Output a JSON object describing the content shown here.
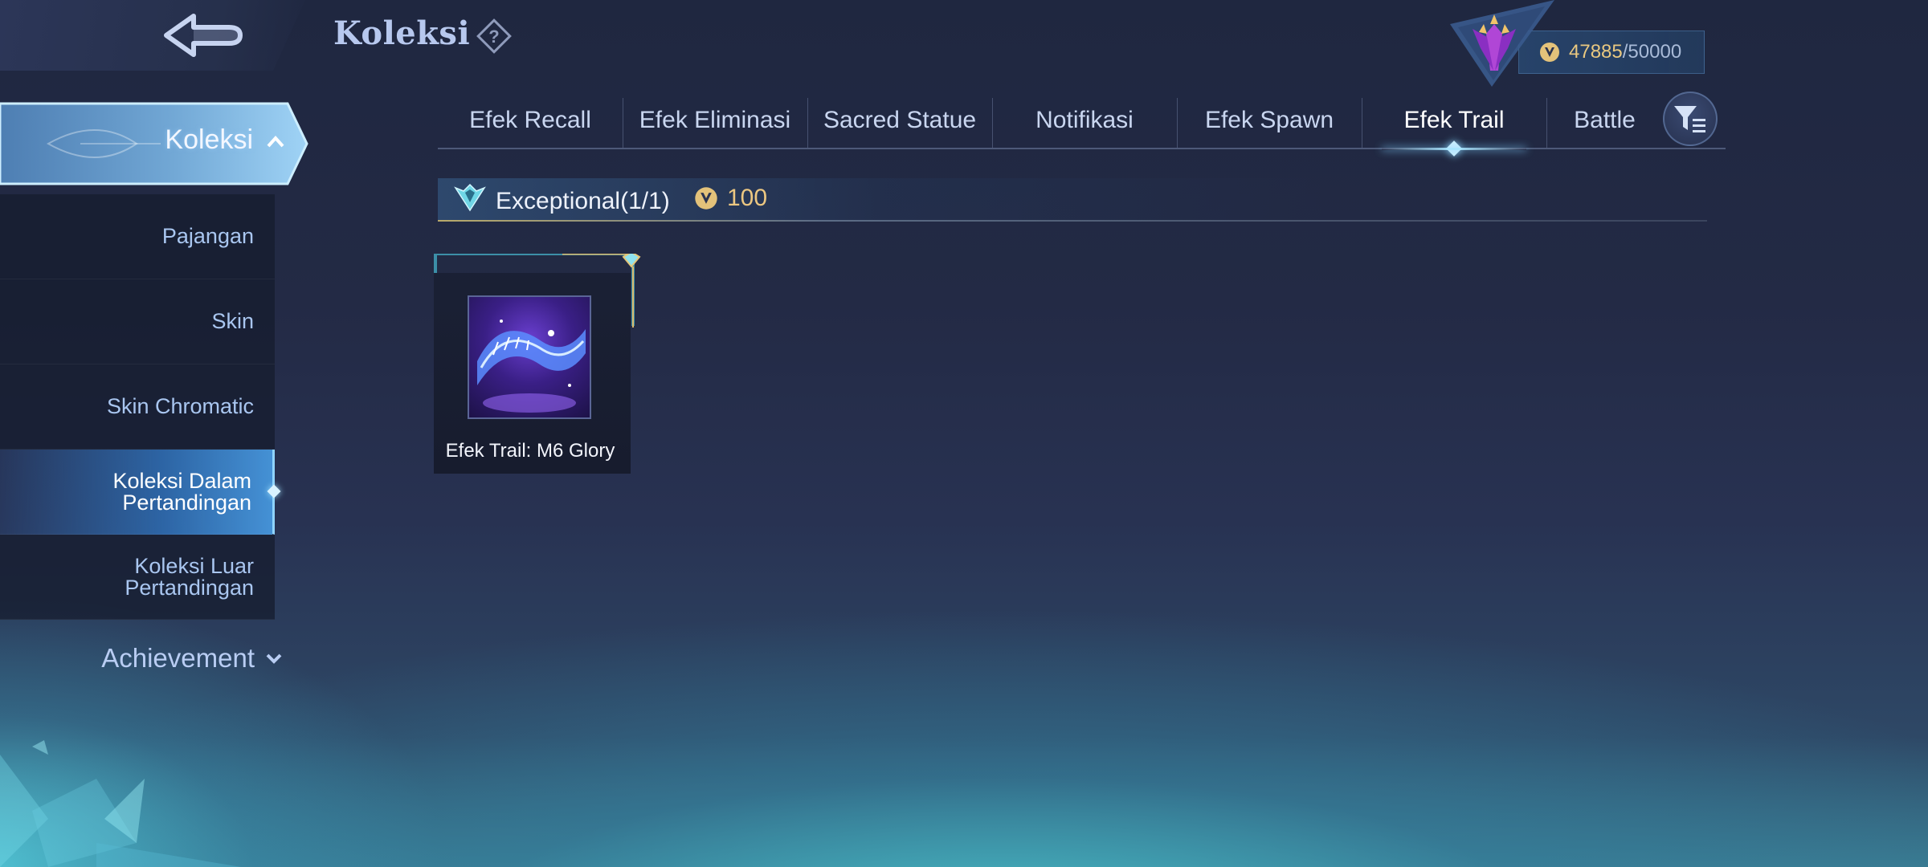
{
  "header": {
    "title": "Koleksi",
    "points": {
      "current": "47885",
      "separator": "/",
      "max": "50000"
    }
  },
  "sidebar": {
    "main": {
      "label": "Koleksi"
    },
    "items": [
      {
        "label": "Pajangan"
      },
      {
        "label": "Skin"
      },
      {
        "label": "Skin Chromatic"
      },
      {
        "label": "Koleksi Dalam Pertandingan",
        "active": true
      },
      {
        "label": "Koleksi Luar Pertandingan"
      }
    ],
    "achievement": {
      "label": "Achievement"
    }
  },
  "tabs": [
    {
      "label": "Efek Recall"
    },
    {
      "label": "Efek Eliminasi"
    },
    {
      "label": "Sacred Statue"
    },
    {
      "label": "Notifikasi"
    },
    {
      "label": "Efek Spawn"
    },
    {
      "label": "Efek Trail",
      "active": true
    },
    {
      "label": "Battle"
    }
  ],
  "section": {
    "title": "Exceptional",
    "count": "(1/1)",
    "points": "100"
  },
  "items": [
    {
      "name": "Efek Trail: M6 Glory"
    }
  ],
  "colors": {
    "accent": "#8fd4ff",
    "gold": "#e9c880",
    "active_tab": "#ffffff"
  }
}
